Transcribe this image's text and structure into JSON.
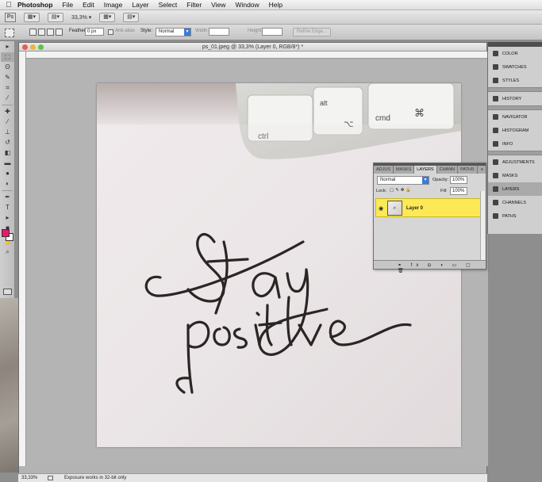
{
  "menubar": {
    "app_name": "Photoshop",
    "items": [
      "File",
      "Edit",
      "Image",
      "Layer",
      "Select",
      "Filter",
      "View",
      "Window",
      "Help"
    ]
  },
  "appbar": {
    "logo": "Ps",
    "zoom": "33,3%"
  },
  "options": {
    "feather_label": "Feather:",
    "feather_value": "0 px",
    "antialias_label": "Anti-alias",
    "style_label": "Style:",
    "style_value": "Normal",
    "width_label": "Width:",
    "height_label": "Height:",
    "refine_edge": "Refine Edge..."
  },
  "document": {
    "title": "ps_01.jpeg @ 33,3% (Layer 0, RGB/8*) *"
  },
  "photo": {
    "key_ctrl": "ctrl",
    "key_alt": "alt",
    "key_cmd": "cmd",
    "key_opt_symbol": "⌥",
    "key_cmd_symbol": "⌘"
  },
  "layers_panel": {
    "tabs": [
      "ADJUS",
      "MASKS",
      "LAYERS",
      "CHANN",
      "PATHS"
    ],
    "active_tab": 2,
    "blend_mode": "Normal",
    "opacity_label": "Opacity:",
    "opacity_value": "100%",
    "lock_label": "Lock:",
    "fill_label": "Fill:",
    "fill_value": "100%",
    "layer_name": "Layer 0"
  },
  "dock": {
    "group1": [
      "COLOR",
      "SWATCHES",
      "STYLES"
    ],
    "group2": [
      "HISTORY"
    ],
    "group3": [
      "NAVIGATOR",
      "HISTOGRAM",
      "INFO"
    ],
    "group4": [
      "ADJUSTMENTS",
      "MASKS",
      "LAYERS",
      "CHANNELS",
      "PATHS"
    ],
    "active": "LAYERS"
  },
  "status": {
    "zoom": "33,33%",
    "message": "Exposure works in 32-bit only"
  },
  "colors": {
    "foreground": "#e6186e",
    "background": "#ffffff",
    "layer_highlight": "#fce955"
  }
}
